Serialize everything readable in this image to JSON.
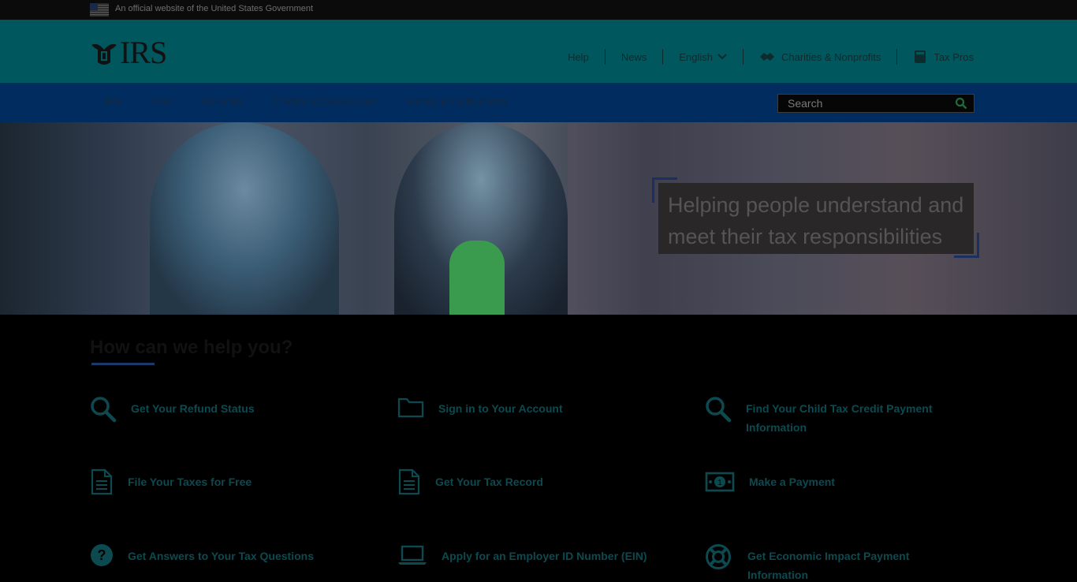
{
  "gov_banner": {
    "text": "An official website of the United States Government",
    "flag_icon": "us-flag-icon"
  },
  "header": {
    "logo_text": "IRS",
    "utility_nav": {
      "help": "Help",
      "news": "News",
      "language": "English",
      "charities": "Charities & Nonprofits",
      "tax_pros": "Tax Pros"
    }
  },
  "main_nav": {
    "items": [
      "File",
      "Pay",
      "Refunds",
      "Credits & Deductions",
      "Forms & Instructions"
    ],
    "search_placeholder": "Search"
  },
  "hero": {
    "line1": "Helping people understand and",
    "line2": "meet their tax responsibilities"
  },
  "help_section": {
    "title": "How can we help you?",
    "tiles": [
      {
        "label": "Get Your Refund Status",
        "icon": "search-icon"
      },
      {
        "label": "Sign in to Your Account",
        "icon": "folder-icon"
      },
      {
        "label": "Find Your Child Tax Credit Payment Information",
        "icon": "search-icon"
      },
      {
        "label": "File Your Taxes for Free",
        "icon": "document-icon"
      },
      {
        "label": "Get Your Tax Record",
        "icon": "document-icon"
      },
      {
        "label": "Make a Payment",
        "icon": "money-icon"
      },
      {
        "label": "Get Answers to Your Tax Questions",
        "icon": "question-icon"
      },
      {
        "label": "Apply for an Employer ID Number (EIN)",
        "icon": "laptop-icon"
      },
      {
        "label": "Get Economic Impact Payment Information",
        "icon": "lifebuoy-icon"
      }
    ]
  },
  "colors": {
    "header_bg": "#00575d",
    "nav_bg": "#002c60",
    "tile_text": "#0c4a50",
    "page_bg": "#000000"
  }
}
